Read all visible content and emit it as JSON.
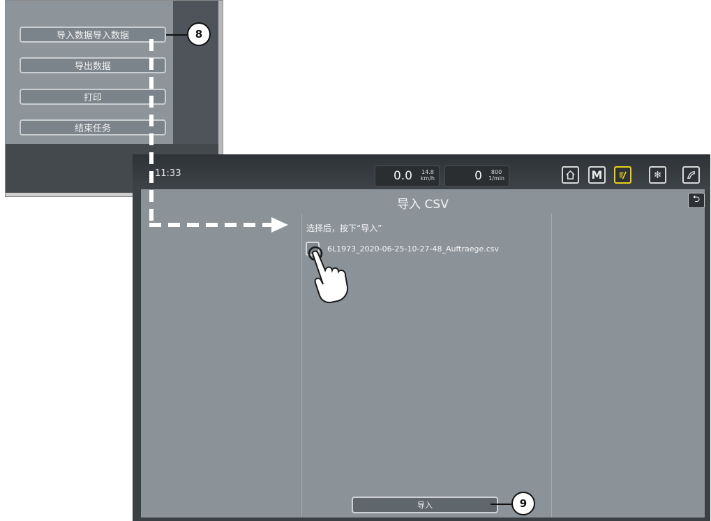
{
  "menu": {
    "items": [
      {
        "label": "导入数据导入数据"
      },
      {
        "label": "导出数据"
      },
      {
        "label": "打印"
      },
      {
        "label": "结束任务"
      }
    ]
  },
  "callouts": {
    "first": "8",
    "second": "9"
  },
  "status_bar": {
    "time": "11:33",
    "speed": {
      "value": "0.0",
      "sub_value": "14.8",
      "unit": "km/h"
    },
    "rpm": {
      "value": "0",
      "sub_value": "800",
      "unit": "1/min"
    },
    "icons": [
      "home-icon",
      "m-mode-icon",
      "job-icon",
      "snowflake-icon",
      "sweep-icon"
    ]
  },
  "main": {
    "title": "导入 CSV",
    "instruction": "选择后，按下“导入”",
    "file": {
      "name": "6L1973_2020-06-25-10-27-48_Auftraege.csv",
      "checked": false
    },
    "import_button_label": "导入"
  },
  "colors": {
    "panel_bg": "#8b9399",
    "dark_bar": "#3b4044",
    "accent_yellow": "#e8d21a"
  }
}
